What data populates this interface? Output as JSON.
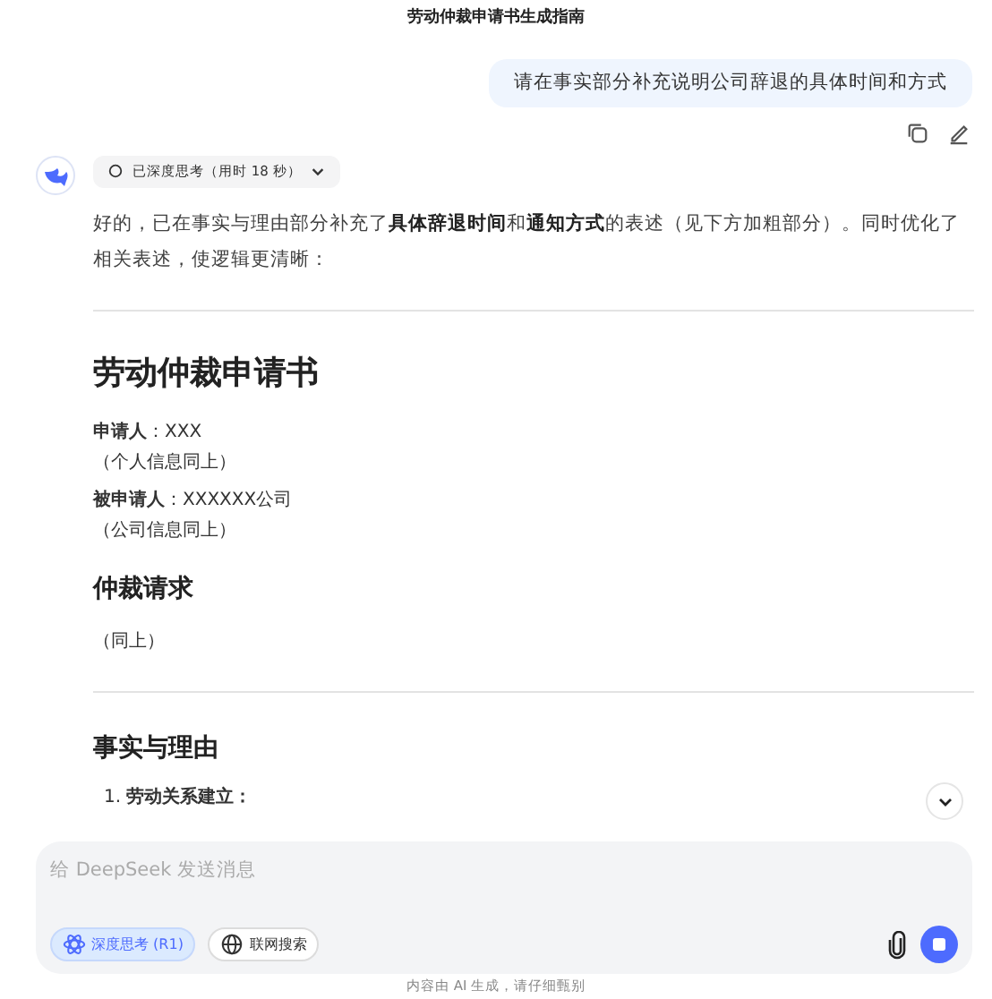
{
  "header": {
    "title": "劳动仲裁申请书生成指南"
  },
  "user_message": {
    "text": "请在事实部分补充说明公司辞退的具体时间和方式"
  },
  "thinking_chip": {
    "label": "已深度思考（用时 18 秒）",
    "expanded": false
  },
  "answer": {
    "intro": "好的，已在事实与理由部分补充了**具体辞退时间**和**通知方式**的表述（见下方加粗部分）。同时优化了相关表述，使逻辑更清晰：",
    "blocks": [
      {
        "kind": "divider"
      },
      {
        "kind": "h1",
        "text": "劳动仲裁申请书"
      },
      {
        "kind": "field",
        "label": "申请人",
        "value": "：XXX"
      },
      {
        "kind": "note",
        "text": "（个人信息同上）"
      },
      {
        "kind": "field",
        "label": "被申请人",
        "value": "：XXXXXX公司"
      },
      {
        "kind": "note",
        "text": "（公司信息同上）"
      },
      {
        "kind": "h2",
        "text": "仲裁请求"
      },
      {
        "kind": "note",
        "text": "（同上）"
      },
      {
        "kind": "divider"
      },
      {
        "kind": "h2",
        "text": "事实与理由"
      },
      {
        "kind": "list_item",
        "number": "1.",
        "text": "劳动关系建立："
      }
    ]
  },
  "composer": {
    "placeholder": "给 DeepSeek 发送消息",
    "toggles": [
      {
        "kind": "deepthink",
        "label": "深度思考 (R1)",
        "on": true
      },
      {
        "kind": "search",
        "label": "联网搜索",
        "on": false
      }
    ]
  },
  "footer": {
    "text": "内容由 AI 生成，请仔细甄别"
  }
}
